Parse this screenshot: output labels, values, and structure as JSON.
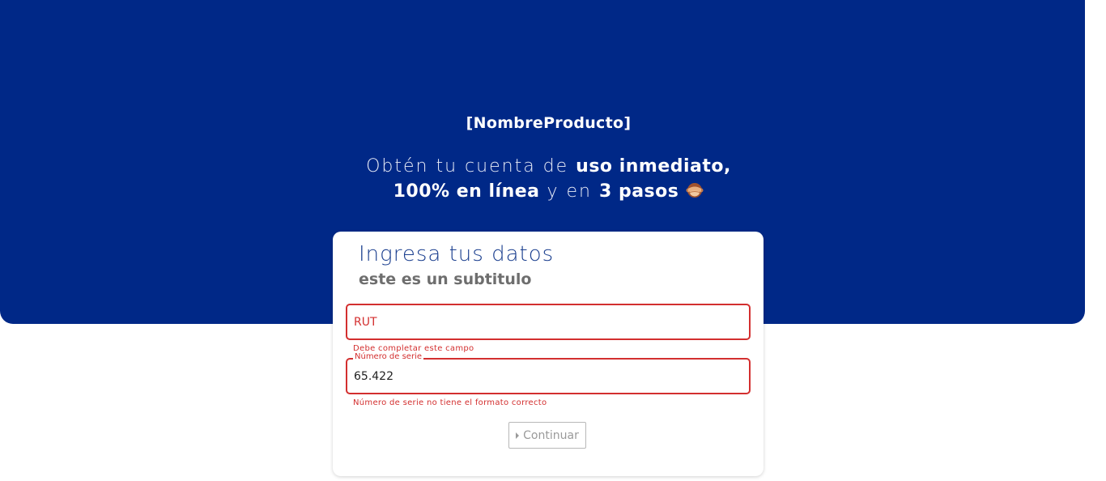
{
  "hero": {
    "product_name": "[NombreProducto]",
    "tagline_part1": "Obtén tu cuenta de ",
    "tagline_bold1": "uso inmediato,",
    "tagline_bold2": "100% en línea",
    "tagline_part2": " y en ",
    "tagline_bold3": "3 pasos",
    "emoji_icon": "see-no-evil-monkey-icon",
    "background_color": "#002887"
  },
  "form": {
    "title": "Ingresa tus datos",
    "subtitle": "este es un subtitulo",
    "rut": {
      "placeholder": "RUT",
      "value": "",
      "error": "Debe completar este campo"
    },
    "serie": {
      "label": "Número de serie",
      "value": "65.422",
      "error": "Número de serie no tiene el formato correcto"
    },
    "continue_label": "Continuar",
    "error_color": "#d32f2f",
    "title_color": "#1b3f8f"
  }
}
